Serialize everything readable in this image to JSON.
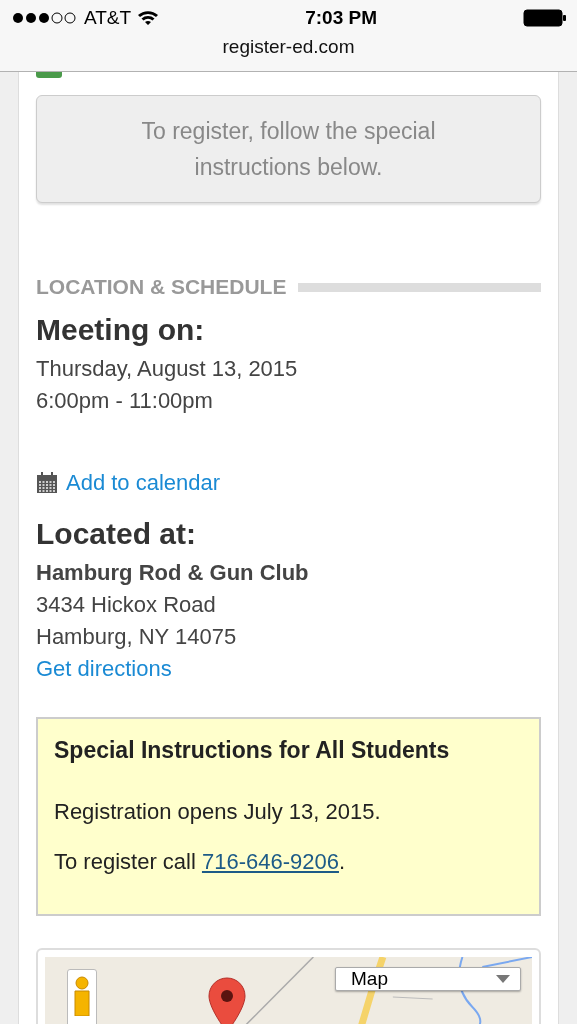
{
  "status_bar": {
    "carrier": "AT&T",
    "time": "7:03 PM"
  },
  "url_bar": {
    "address": "register-ed.com"
  },
  "notice": {
    "text": "To register, follow the special instructions below."
  },
  "section": {
    "title": "LOCATION & SCHEDULE"
  },
  "schedule": {
    "heading": "Meeting on:",
    "date": "Thursday, August 13, 2015",
    "time": "6:00pm - 11:00pm",
    "calendar_link": "Add to calendar"
  },
  "location": {
    "heading": "Located at:",
    "name": "Hamburg Rod & Gun Club",
    "street": "3434 Hickox Road",
    "city": "Hamburg, NY 14075",
    "directions_link": "Get directions"
  },
  "instructions": {
    "title": "Special Instructions for All Students",
    "lines": [
      {
        "text": "Registration opens July 13, 2015."
      },
      {
        "text": "To register call ",
        "phone": "716-646-9206",
        "after": "."
      }
    ]
  },
  "map": {
    "kind": "picture",
    "type_select": "Map"
  }
}
